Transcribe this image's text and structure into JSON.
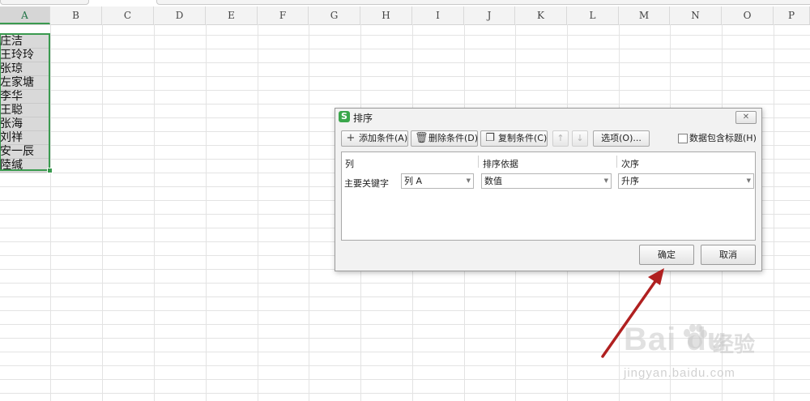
{
  "sheet": {
    "columns": [
      "A",
      "B",
      "C",
      "D",
      "E",
      "F",
      "G",
      "H",
      "I",
      "J",
      "K",
      "L",
      "M",
      "N",
      "O",
      "P"
    ],
    "selected_column": "A",
    "cells_a": [
      "庄洁",
      "王玲玲",
      "张琼",
      "左家塘",
      "李华",
      "王聪",
      "张海",
      "刘祥",
      "安一辰",
      "陸缄"
    ]
  },
  "dialog": {
    "title": "排序",
    "logo": "S",
    "close": "✕",
    "toolbar": {
      "add": "添加条件(A)",
      "delete": "删除条件(D)",
      "copy": "复制条件(C)",
      "up_icon": "↑",
      "down_icon": "↓",
      "options": "选项(O)...",
      "header_checkbox": "数据包含标题(H)"
    },
    "headers": {
      "column": "列",
      "sort_on": "排序依据",
      "order": "次序"
    },
    "row": {
      "label": "主要关键字",
      "column_value": "列 A",
      "sort_on_value": "数值",
      "order_value": "升序"
    },
    "buttons": {
      "ok": "确定",
      "cancel": "取消"
    }
  },
  "watermark": {
    "logo": "Bai du",
    "cn": "经验",
    "url": "jingyan.baidu.com"
  },
  "colors": {
    "selection": "#3a9a4f",
    "arrow": "#b02020",
    "logo": "#3aa64b"
  }
}
